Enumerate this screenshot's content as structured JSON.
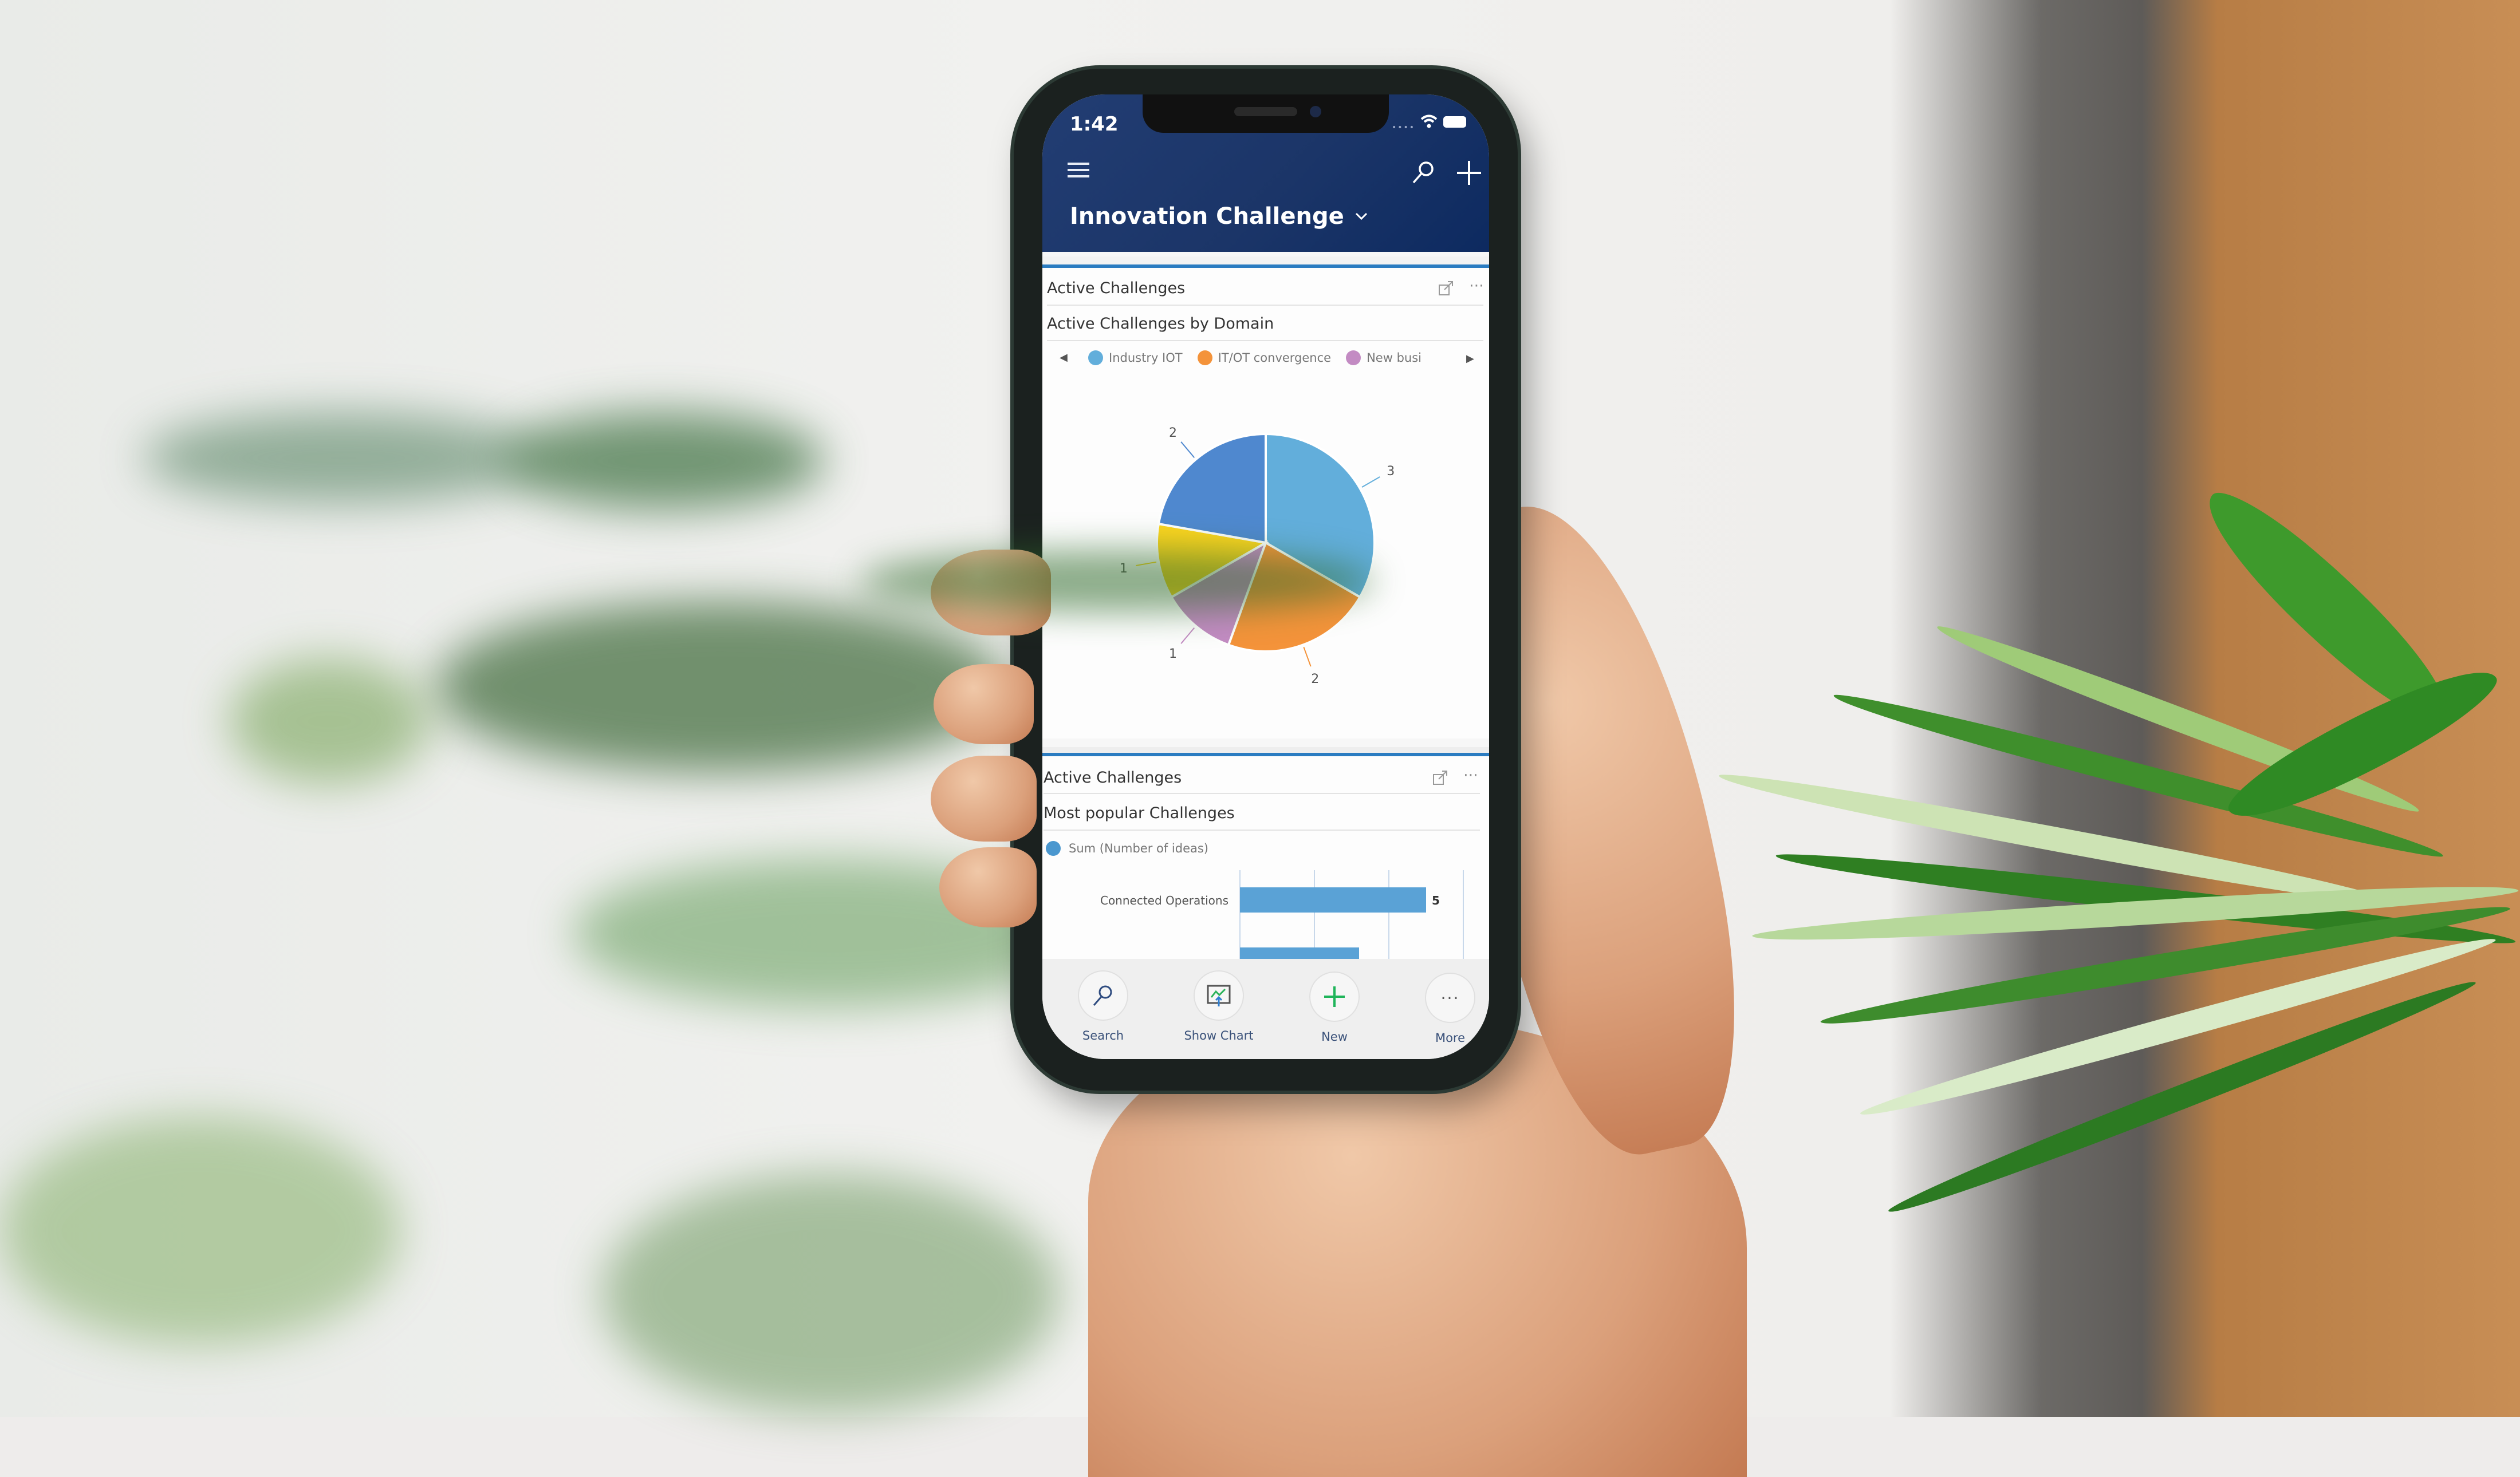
{
  "status_bar": {
    "time": "1:42"
  },
  "header": {
    "title": "Innovation Challenge",
    "menu_icon": "hamburger-icon",
    "search_icon": "search-icon",
    "add_icon": "plus-icon"
  },
  "cards": [
    {
      "header": "Active Challenges",
      "subtitle": "Active Challenges by Domain",
      "expand_icon": "expand-icon",
      "more_icon": "ellipsis-icon",
      "legend_prev": "◀",
      "legend_next": "▶",
      "legend": [
        {
          "label": "Industry IOT",
          "color": "#62aedb"
        },
        {
          "label": "IT/OT convergence",
          "color": "#f4933a"
        },
        {
          "label": "New busi",
          "color": "#c38bc3"
        }
      ]
    },
    {
      "header": "Active Challenges",
      "subtitle": "Most popular Challenges",
      "expand_icon": "expand-icon",
      "more_icon": "ellipsis-icon",
      "legend": [
        {
          "label": "Sum (Number of ideas)",
          "color": "#4a97cf"
        }
      ]
    }
  ],
  "toolbar": {
    "items": [
      {
        "label": "Search",
        "icon": "search-icon"
      },
      {
        "label": "Show Chart",
        "icon": "chart-icon"
      },
      {
        "label": "New",
        "icon": "plus-icon"
      },
      {
        "label": "More",
        "icon": "ellipsis-icon"
      }
    ]
  },
  "chart_data": [
    {
      "type": "pie",
      "title": "Active Challenges by Domain",
      "categories": [
        "Industry IOT",
        "IT/OT convergence",
        "New busi",
        "(yellow segment)",
        "(dark blue segment)"
      ],
      "values": [
        3,
        2,
        1,
        1,
        2
      ],
      "colors": [
        "#62aedb",
        "#f4933a",
        "#c38bc3",
        "#fdd51f",
        "#4f88cf"
      ],
      "data_labels": [
        "3",
        "2",
        "1",
        "1",
        "2"
      ],
      "legend": "top"
    },
    {
      "type": "bar",
      "orientation": "horizontal",
      "title": "Most popular Challenges",
      "series": [
        {
          "name": "Sum (Number of ideas)",
          "values": [
            5,
            4
          ]
        }
      ],
      "categories": [
        "Connected Operations",
        ""
      ],
      "data_labels": [
        "5",
        ""
      ],
      "xlim": [
        0,
        6
      ],
      "grid": true,
      "legend": "top-left"
    }
  ]
}
